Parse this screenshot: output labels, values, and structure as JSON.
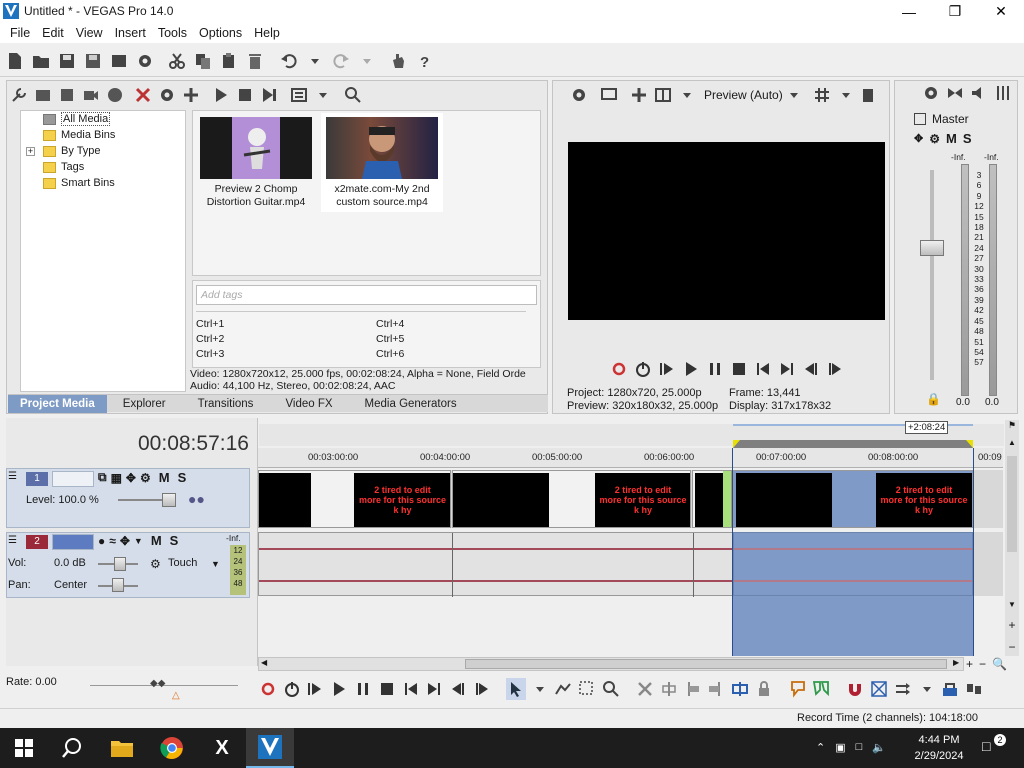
{
  "window": {
    "title": "Untitled * - VEGAS Pro 14.0",
    "app_icon": "vegas-logo-icon",
    "controls": [
      "minimize-icon",
      "maximize-icon",
      "close-icon"
    ]
  },
  "menu": [
    "File",
    "Edit",
    "View",
    "Insert",
    "Tools",
    "Options",
    "Help"
  ],
  "project_media": {
    "tree": [
      "All Media",
      "Media Bins",
      "By Type",
      "Tags",
      "Smart Bins"
    ],
    "media": [
      {
        "name": "Preview 2 Chomp Distortion Guitar.mp4",
        "line1": "Preview 2 Chomp",
        "line2": "Distortion Guitar.mp4"
      },
      {
        "name": "x2mate.com-My 2nd custom source.mp4",
        "line1": "x2mate.com-My 2nd",
        "line2": "custom source.mp4"
      }
    ],
    "tags_placeholder": "Add tags",
    "shortcuts_left": [
      "Ctrl+1",
      "Ctrl+2",
      "Ctrl+3"
    ],
    "shortcuts_right": [
      "Ctrl+4",
      "Ctrl+5",
      "Ctrl+6"
    ],
    "info_video": "Video: 1280x720x12, 25.000 fps, 00:02:08:24, Alpha = None, Field Orde",
    "info_audio": "Audio: 44,100 Hz, Stereo, 00:02:08:24, AAC",
    "tabs": [
      "Project Media",
      "Explorer",
      "Transitions",
      "Video FX",
      "Media Generators"
    ]
  },
  "preview": {
    "mode": "Preview (Auto)",
    "project_label": "Project:",
    "project_value": "1280x720, 25.000p",
    "preview_label": "Preview:",
    "preview_value": "320x180x32, 25.000p",
    "frame_label": "Frame:",
    "frame_value": "13,441",
    "display_label": "Display:",
    "display_value": "317x178x32"
  },
  "master": {
    "title": "Master",
    "m": "M",
    "s": "S",
    "scale_top": "-Inf.",
    "scale": [
      "3",
      "6",
      "9",
      "12",
      "15",
      "18",
      "21",
      "24",
      "27",
      "30",
      "33",
      "36",
      "39",
      "42",
      "45",
      "48",
      "51",
      "54",
      "57"
    ],
    "left_value": "0.0",
    "right_value": "0.0"
  },
  "timeline": {
    "timecode": "00:08:57:16",
    "loop_length": "+2:08:24",
    "ruler": [
      {
        "label": "00:03:00:00"
      },
      {
        "label": "00:04:00:00"
      },
      {
        "label": "00:05:00:00"
      },
      {
        "label": "00:06:00:00"
      },
      {
        "label": "00:07:00:00"
      },
      {
        "label": "00:08:00:00"
      },
      {
        "label": "00:09"
      }
    ],
    "video_track": {
      "number": "1",
      "m": "M",
      "s": "S",
      "level": "Level: 100.0 %"
    },
    "audio_track": {
      "number": "2",
      "m": "M",
      "s": "S",
      "vol_label": "Vol:",
      "vol_value": "0.0 dB",
      "pan_label": "Pan:",
      "pan_value": "Center",
      "automation": "Touch",
      "meter_top": "-Inf.",
      "meter": [
        "12",
        "24",
        "36",
        "48"
      ]
    },
    "clip_text": [
      "2 tired to edit",
      "more for this source",
      "k hy"
    ],
    "rate": "Rate: 0.00"
  },
  "status": {
    "record_time": "Record Time (2 channels): 104:18:00"
  },
  "taskbar": {
    "icons": [
      "windows-start-icon",
      "search-icon",
      "file-explorer-icon",
      "chrome-icon",
      "x-icon",
      "vegas-taskbar-icon"
    ],
    "time": "4:44 PM",
    "date": "2/29/2024"
  },
  "colors": {
    "selection": "#7e9bc5",
    "track_header": "#d4dde9",
    "waveform": "#a24a5a",
    "clip_text": "#ff3030"
  }
}
